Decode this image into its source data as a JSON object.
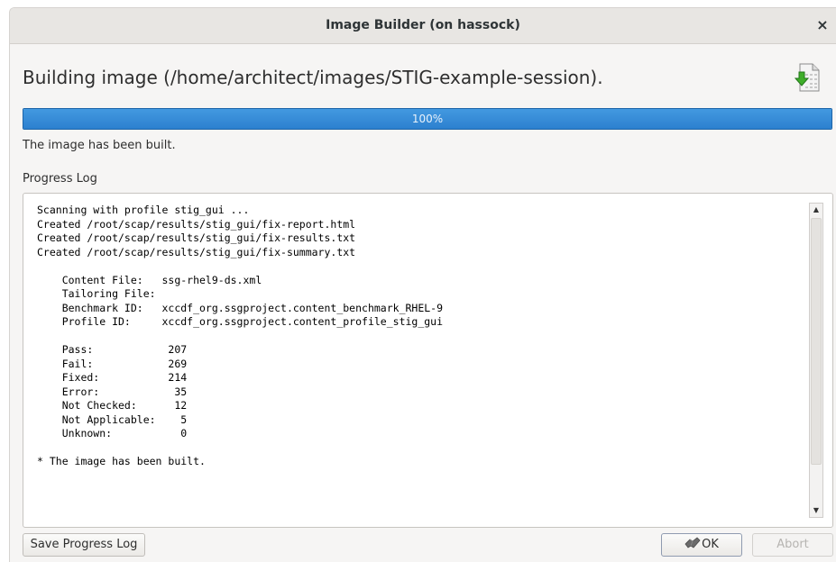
{
  "window": {
    "title": "Image Builder (on hassock)",
    "close_symbol": "×"
  },
  "heading": "Building image (/home/architect/images/STIG-example-session).",
  "heading_icon": "document-download-icon",
  "progress": {
    "fraction": 1.0,
    "label": "100%",
    "fill_color": "#3a8ee0"
  },
  "status": "The image has been built.",
  "log": {
    "label": "Progress Log",
    "text": "Scanning with profile stig_gui ...\nCreated /root/scap/results/stig_gui/fix-report.html\nCreated /root/scap/results/stig_gui/fix-results.txt\nCreated /root/scap/results/stig_gui/fix-summary.txt\n\n    Content File:   ssg-rhel9-ds.xml\n    Tailoring File:\n    Benchmark ID:   xccdf_org.ssgproject.content_benchmark_RHEL-9\n    Profile ID:     xccdf_org.ssgproject.content_profile_stig_gui\n\n    Pass:            207\n    Fail:            269\n    Fixed:           214\n    Error:            35\n    Not Checked:      12\n    Not Applicable:    5\n    Unknown:           0\n\n* The image has been built."
  },
  "buttons": {
    "save_log": "Save Progress Log",
    "ok": "OK",
    "abort": "Abort"
  }
}
